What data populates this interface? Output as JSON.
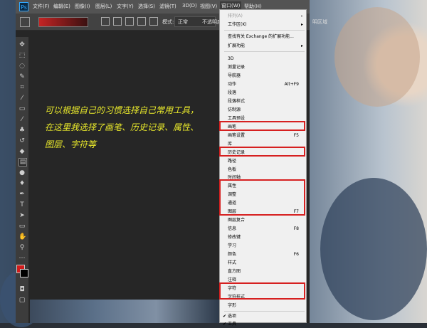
{
  "menubar": {
    "app_icon": "Ps",
    "items": [
      "文件(F)",
      "编辑(E)",
      "图像(I)",
      "图层(L)",
      "文字(Y)",
      "选择(S)",
      "滤镜(T)",
      "3D(D)",
      "视图(V)",
      "窗口(W)",
      "帮助(H)"
    ]
  },
  "options": {
    "mode_label": "模式:",
    "mode_value": "正常",
    "opacity_label": "不透明度",
    "right_label": "明区域"
  },
  "caption": {
    "line1": "可以根据自己的习惯选择自己常用工具，",
    "line2": "在这里我选择了画笔、历史记录、属性、",
    "line3": "图层、字符等"
  },
  "window_menu": {
    "items": [
      {
        "label": "排列(A)",
        "disabled": true,
        "submenu": true
      },
      {
        "label": "工作区(K)",
        "submenu": true
      },
      {
        "label": "查找有关 Exchange 的扩展功能..."
      },
      {
        "label": "扩展功能",
        "submenu": true
      },
      {
        "label": "3D"
      },
      {
        "label": "测量记录"
      },
      {
        "label": "导航器"
      },
      {
        "label": "动作",
        "shortcut": "Alt+F9"
      },
      {
        "label": "段落"
      },
      {
        "label": "段落样式"
      },
      {
        "label": "仿制源"
      },
      {
        "label": "工具预设"
      },
      {
        "label": "画笔"
      },
      {
        "label": "画笔设置",
        "shortcut": "F5"
      },
      {
        "label": "库"
      },
      {
        "label": "历史记录"
      },
      {
        "label": "路径"
      },
      {
        "label": "色板"
      },
      {
        "label": "时间轴"
      },
      {
        "label": "属性"
      },
      {
        "label": "调整"
      },
      {
        "label": "通道"
      },
      {
        "label": "图层",
        "shortcut": "F7"
      },
      {
        "label": "图层复合"
      },
      {
        "label": "信息",
        "shortcut": "F8"
      },
      {
        "label": "修改键"
      },
      {
        "label": "学习"
      },
      {
        "label": "颜色",
        "shortcut": "F6"
      },
      {
        "label": "样式"
      },
      {
        "label": "直方图"
      },
      {
        "label": "注释"
      },
      {
        "label": "字符"
      },
      {
        "label": "字符样式"
      },
      {
        "label": "字形"
      },
      {
        "label": "选项",
        "checked": true
      },
      {
        "label": "工具",
        "checked": true
      }
    ]
  },
  "highlight_color": "#d62020",
  "caption_color": "#e9e92b"
}
